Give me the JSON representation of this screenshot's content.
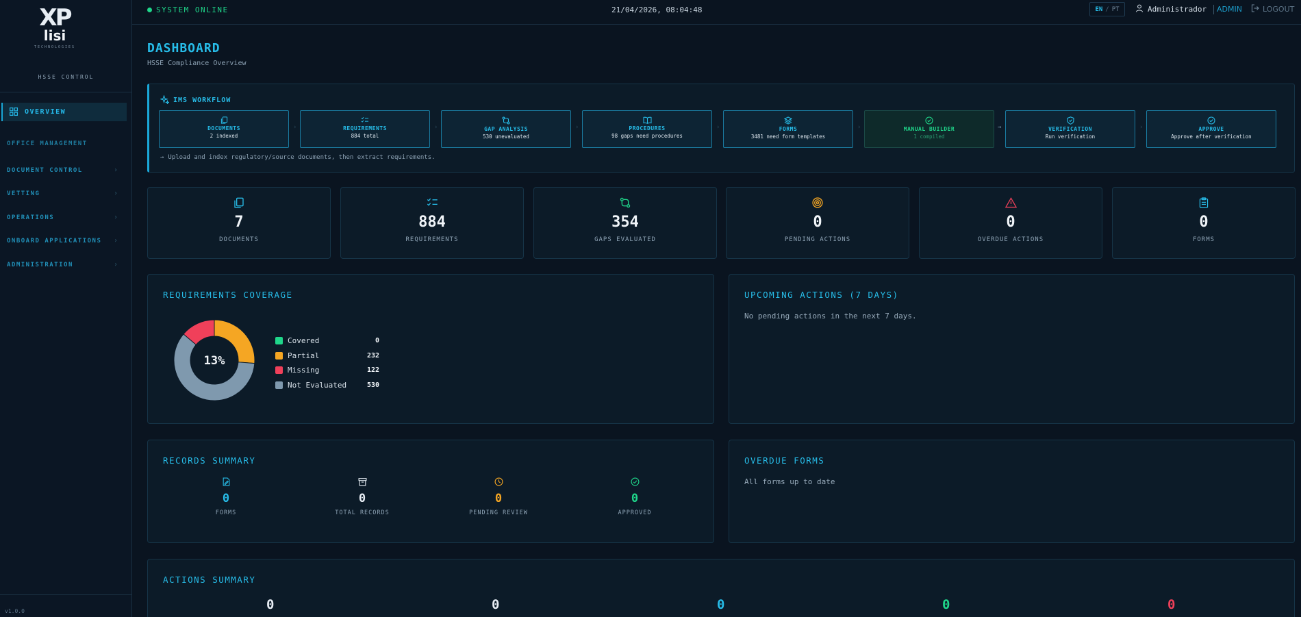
{
  "brand": {
    "logo_mark": "XP",
    "logo_word": "lisi",
    "logo_sub": "TECHNOLOGIES",
    "section": "HSSE CONTROL",
    "version": "v1.0.0"
  },
  "sidebar": {
    "active": {
      "label": "OVERVIEW",
      "icon": "grid-icon"
    },
    "section_label": "OFFICE MANAGEMENT",
    "items": [
      {
        "label": "DOCUMENT CONTROL"
      },
      {
        "label": "VETTING"
      },
      {
        "label": "OPERATIONS"
      },
      {
        "label": "ONBOARD APPLICATIONS"
      },
      {
        "label": "ADMINISTRATION"
      }
    ]
  },
  "header": {
    "status": "SYSTEM ONLINE",
    "datetime": "21/04/2026, 08:04:48",
    "lang_en": "EN",
    "lang_sep": "/",
    "lang_pt": "PT",
    "user": "Administrador",
    "role": "ADMIN",
    "logout": "LOGOUT"
  },
  "page": {
    "title": "DASHBOARD",
    "subtitle": "HSSE Compliance Overview"
  },
  "workflow": {
    "title": "IMS WORKFLOW",
    "hint": "Upload and index regulatory/source documents, then extract requirements.",
    "hint_icon": "arrow-right-icon",
    "steps": [
      {
        "name": "DOCUMENTS",
        "desc": "2 indexed",
        "icon": "files-icon"
      },
      {
        "name": "REQUIREMENTS",
        "desc": "884 total",
        "icon": "checklist-icon"
      },
      {
        "name": "GAP ANALYSIS",
        "desc": "530 unevaluated",
        "icon": "compare-icon"
      },
      {
        "name": "PROCEDURES",
        "desc": "98 gaps need procedures",
        "icon": "book-icon"
      },
      {
        "name": "FORMS",
        "desc": "3481 need form templates",
        "icon": "layers-icon"
      },
      {
        "name": "MANUAL BUILDER",
        "desc": "1 compiled",
        "icon": "check-circle-icon"
      },
      {
        "name": "VERIFICATION",
        "desc": "Run verification",
        "icon": "shield-check-icon"
      },
      {
        "name": "APPROVE",
        "desc": "Approve after verification",
        "icon": "check-circle-icon"
      }
    ]
  },
  "stats": [
    {
      "value": "7",
      "label": "DOCUMENTS",
      "icon": "files-icon",
      "color": "#27bde9"
    },
    {
      "value": "884",
      "label": "REQUIREMENTS",
      "icon": "checklist-icon",
      "color": "#27bde9"
    },
    {
      "value": "354",
      "label": "GAPS EVALUATED",
      "icon": "compare-icon",
      "color": "#1fd68a"
    },
    {
      "value": "0",
      "label": "PENDING ACTIONS",
      "icon": "target-icon",
      "color": "#f5a623"
    },
    {
      "value": "0",
      "label": "OVERDUE ACTIONS",
      "icon": "alert-triangle-icon",
      "color": "#f0405a"
    },
    {
      "value": "0",
      "label": "FORMS",
      "icon": "clipboard-icon",
      "color": "#27bde9"
    }
  ],
  "coverage": {
    "title": "REQUIREMENTS COVERAGE",
    "center_label": "13%",
    "chart_data": {
      "type": "pie",
      "categories": [
        "Covered",
        "Partial",
        "Missing",
        "Not Evaluated"
      ],
      "values": [
        0,
        232,
        122,
        530
      ],
      "colors": [
        "#1fd68a",
        "#f5a623",
        "#f0405a",
        "#7f99ae"
      ]
    }
  },
  "upcoming": {
    "title": "UPCOMING ACTIONS (7 DAYS)",
    "text": "No pending actions in the next 7 days."
  },
  "records": {
    "title": "RECORDS SUMMARY",
    "items": [
      {
        "value": "0",
        "label": "FORMS",
        "icon": "form-edit-icon",
        "color": "#27bde9"
      },
      {
        "value": "0",
        "label": "TOTAL RECORDS",
        "icon": "archive-icon",
        "color": "#e8eef5"
      },
      {
        "value": "0",
        "label": "PENDING REVIEW",
        "icon": "clock-icon",
        "color": "#f5a623"
      },
      {
        "value": "0",
        "label": "APPROVED",
        "icon": "check-circle-icon",
        "color": "#1fd68a"
      }
    ]
  },
  "overdue_forms": {
    "title": "OVERDUE FORMS",
    "text": "All forms up to date"
  },
  "actions": {
    "title": "ACTIONS SUMMARY",
    "values": [
      {
        "value": "0",
        "color": "#e8eef5"
      },
      {
        "value": "0",
        "color": "#e8eef5"
      },
      {
        "value": "0",
        "color": "#27bde9"
      },
      {
        "value": "0",
        "color": "#1fd68a"
      },
      {
        "value": "0",
        "color": "#f0405a"
      }
    ]
  }
}
